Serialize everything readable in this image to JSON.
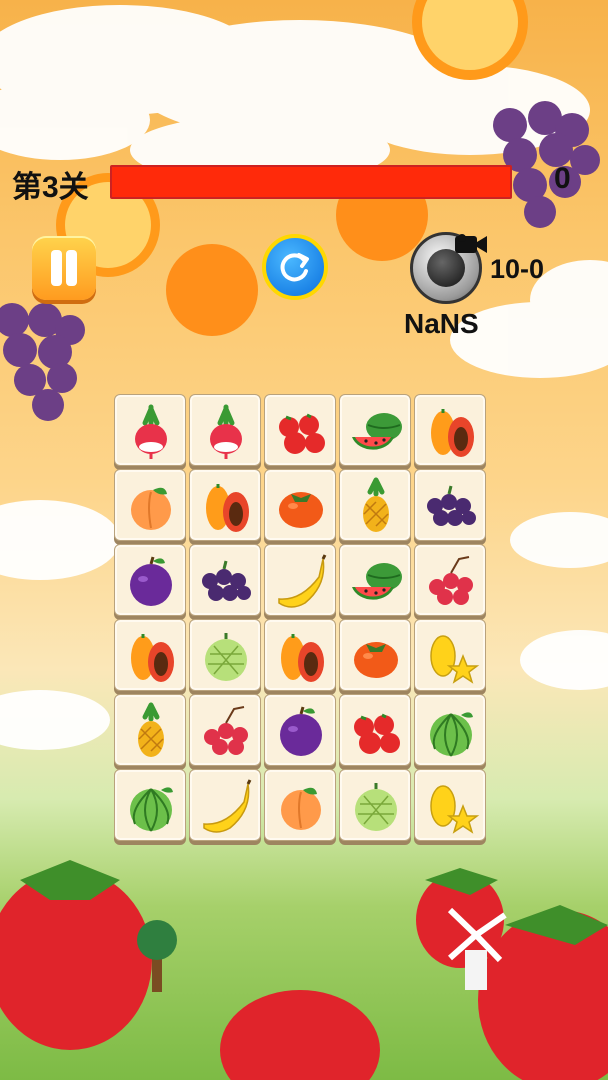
{
  "hud": {
    "level_label": "第3关",
    "progress_fraction": 1.0,
    "score": "0",
    "bomb_count": "10-0",
    "nans_label": "NaNS"
  },
  "icons": {
    "pause": "pause-icon",
    "refresh": "refresh-icon",
    "bomb": "bomb-icon",
    "video": "video-camera-icon"
  },
  "colors": {
    "progress_fill": "#ff2a0a",
    "pause_button": "#ffb52e",
    "refresh_button": "#1f8cf0",
    "refresh_ring": "#ffd800"
  },
  "board": {
    "rows": [
      [
        "radish",
        "radish",
        "tomato",
        "watermelon",
        "papaya"
      ],
      [
        "peach",
        "papaya",
        "persimmon",
        "pineapple",
        "grapes"
      ],
      [
        "plum",
        "grapes",
        "banana",
        "watermelon",
        "lychee"
      ],
      [
        "papaya",
        "custard-apple",
        "papaya",
        "persimmon",
        "starfruit"
      ],
      [
        "pineapple",
        "lychee",
        "plum",
        "tomato",
        "melon"
      ],
      [
        "melon",
        "banana",
        "peach",
        "custard-apple",
        "starfruit"
      ]
    ]
  }
}
